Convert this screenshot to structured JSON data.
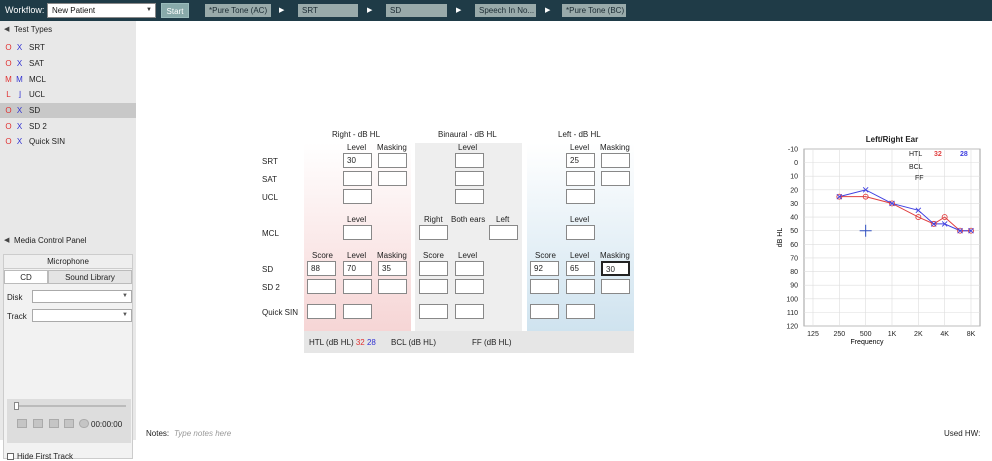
{
  "toolbar": {
    "workflow_label": "Workflow:",
    "workflow_value": "New Patient",
    "start_label": "Start",
    "steps": [
      "*Pure Tone (AC)",
      "SRT",
      "SD",
      "Speech In No...",
      "*Pure Tone (BC)"
    ]
  },
  "test_types": {
    "header": "Test Types",
    "items": [
      {
        "label": "SRT",
        "sym_right": "O",
        "sym_left": "X"
      },
      {
        "label": "SAT",
        "sym_right": "O",
        "sym_left": "X"
      },
      {
        "label": "MCL",
        "sym_right": "M",
        "sym_left": "M"
      },
      {
        "label": "UCL",
        "sym_right": "L",
        "sym_left": "⌋"
      },
      {
        "label": "SD",
        "sym_right": "O",
        "sym_left": "X",
        "selected": true
      },
      {
        "label": "SD 2",
        "sym_right": "O",
        "sym_left": "X"
      },
      {
        "label": "Quick SIN",
        "sym_right": "O",
        "sym_left": "X"
      }
    ]
  },
  "media": {
    "header": "Media Control Panel",
    "microphone": "Microphone",
    "tabs": [
      "CD",
      "Sound Library"
    ],
    "disk_label": "Disk",
    "track_label": "Track",
    "time": "00:00:00",
    "hide_first": "Hide First Track"
  },
  "grid": {
    "right_header": "Right  - dB HL",
    "binaural_header": "Binaural  - dB HL",
    "left_header": "Left  - dB HL",
    "level": "Level",
    "masking": "Masking",
    "score": "Score",
    "right": "Right",
    "both_ears": "Both ears",
    "left": "Left",
    "rows": [
      "SRT",
      "SAT",
      "UCL",
      "MCL",
      "SD",
      "SD 2",
      "Quick SIN"
    ],
    "values": {
      "srt_right_level": "30",
      "srt_left_level": "25",
      "sd_right_score": "88",
      "sd_right_level": "70",
      "sd_right_masking": "35",
      "sd_left_score": "92",
      "sd_left_level": "65",
      "sd_left_masking": "30"
    },
    "footer_htl": "HTL (dB HL)",
    "footer_htl_r": "32",
    "footer_htl_l": "28",
    "footer_bcl": "BCL (dB HL)",
    "footer_ff": "FF (dB HL)"
  },
  "audiogram": {
    "title": "Left/Right Ear",
    "htl": "HTL",
    "htl_right": "32",
    "htl_left": "28",
    "bcl": "BCL",
    "ff": "FF",
    "ylabel": "dB HL",
    "xlabel": "Frequency",
    "y_ticks": [
      "-10",
      "0",
      "10",
      "20",
      "30",
      "40",
      "50",
      "60",
      "70",
      "80",
      "90",
      "100",
      "110",
      "120"
    ],
    "x_ticks": [
      "125",
      "250",
      "500",
      "1K",
      "2K",
      "4K",
      "8K"
    ],
    "right_ear": [
      [
        250,
        25
      ],
      [
        500,
        25
      ],
      [
        1000,
        30
      ],
      [
        2000,
        40
      ],
      [
        3000,
        45
      ],
      [
        4000,
        40
      ],
      [
        6000,
        50
      ],
      [
        8000,
        50
      ]
    ],
    "left_ear": [
      [
        250,
        25
      ],
      [
        500,
        20
      ],
      [
        1000,
        30
      ],
      [
        2000,
        35
      ],
      [
        3000,
        45
      ],
      [
        4000,
        45
      ],
      [
        6000,
        50
      ],
      [
        8000,
        50
      ]
    ],
    "colors": {
      "right": "#e04040",
      "left": "#4040e0"
    }
  },
  "notes": {
    "label": "Notes:",
    "placeholder": "Type notes here"
  },
  "used_hw": "Used HW:"
}
